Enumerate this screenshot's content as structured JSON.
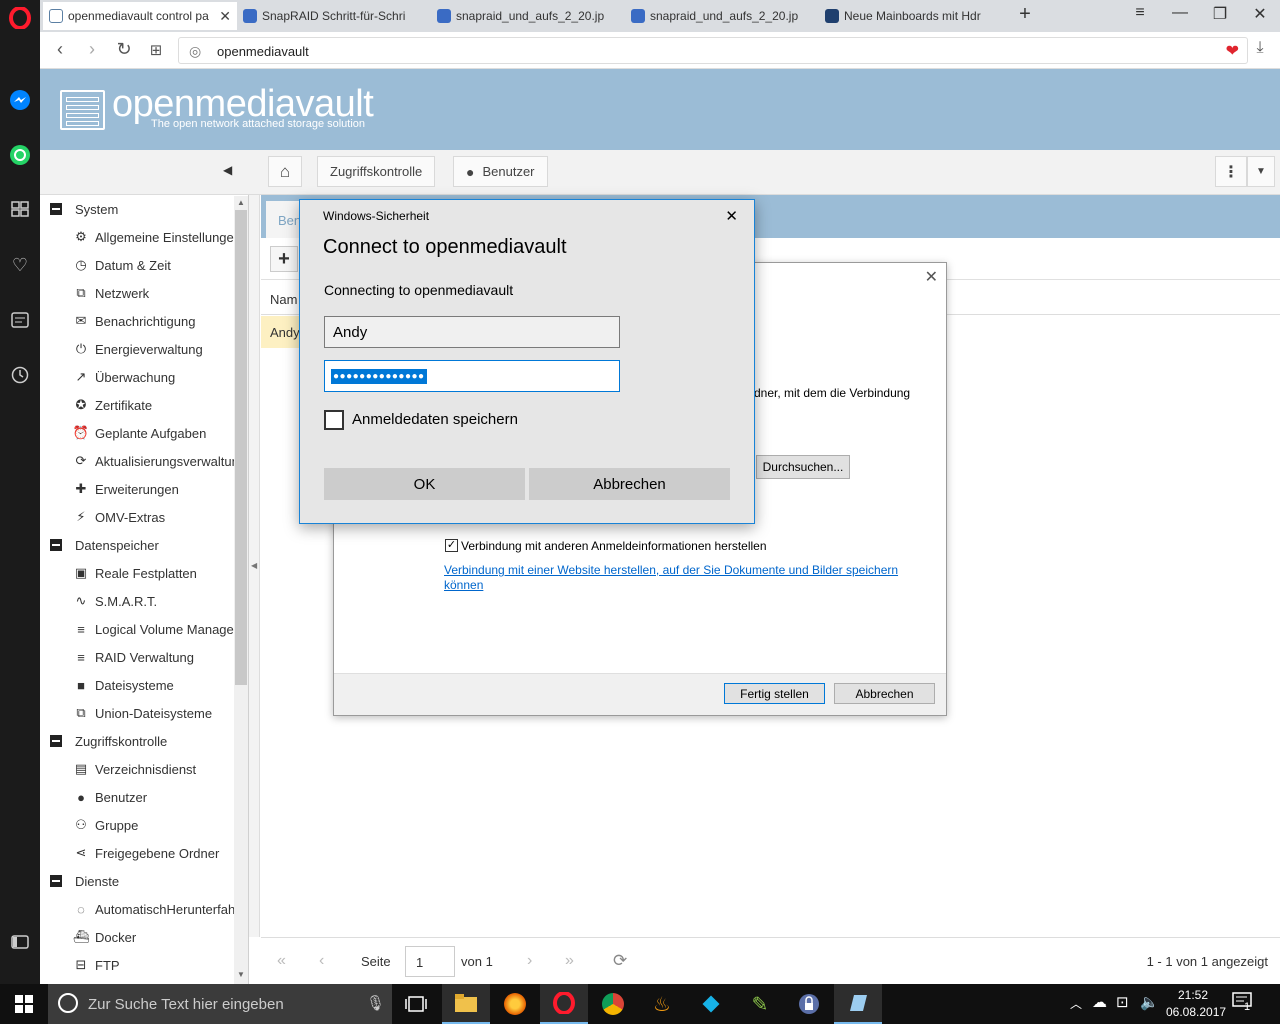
{
  "browser": {
    "tabs": [
      {
        "title": "openmediavault control pa",
        "active": true
      },
      {
        "title": "SnapRAID Schritt-für-Schri",
        "active": false
      },
      {
        "title": "snapraid_und_aufs_2_20.jp",
        "active": false
      },
      {
        "title": "snapraid_und_aufs_2_20.jp",
        "active": false
      },
      {
        "title": "Neue Mainboards mit Hdr",
        "active": false
      }
    ],
    "url": "openmediavault"
  },
  "omv": {
    "logo_title": "openmediavault",
    "logo_tagline": "The open network attached storage solution",
    "breadcrumb": [
      "Zugriffskontrolle",
      "Benutzer"
    ]
  },
  "nav": {
    "groups": [
      {
        "label": "System",
        "items": [
          {
            "icon": "gears-icon",
            "glyph": "⚙",
            "label": "Allgemeine Einstellungen"
          },
          {
            "icon": "clock-icon",
            "glyph": "◷",
            "label": "Datum & Zeit"
          },
          {
            "icon": "network-icon",
            "glyph": "⧉",
            "label": "Netzwerk"
          },
          {
            "icon": "envelope-icon",
            "glyph": "✉",
            "label": "Benachrichtigung"
          },
          {
            "icon": "power-icon",
            "glyph": "⏻",
            "label": "Energieverwaltung"
          },
          {
            "icon": "chart-line-icon",
            "glyph": "↗",
            "label": "Überwachung"
          },
          {
            "icon": "certificate-icon",
            "glyph": "✪",
            "label": "Zertifikate"
          },
          {
            "icon": "alarm-clock-icon",
            "glyph": "⏰",
            "label": "Geplante Aufgaben"
          },
          {
            "icon": "update-icon",
            "glyph": "⟳",
            "label": "Aktualisierungsverwaltung"
          },
          {
            "icon": "puzzle-icon",
            "glyph": "✚",
            "label": "Erweiterungen"
          },
          {
            "icon": "plug-icon",
            "glyph": "⚡",
            "label": "OMV-Extras"
          }
        ]
      },
      {
        "label": "Datenspeicher",
        "items": [
          {
            "icon": "harddisk-icon",
            "glyph": "▣",
            "label": "Reale Festplatten"
          },
          {
            "icon": "smart-chart-icon",
            "glyph": "∿",
            "label": "S.M.A.R.T."
          },
          {
            "icon": "database-icon",
            "glyph": "≡",
            "label": "Logical Volume Management"
          },
          {
            "icon": "raid-icon",
            "glyph": "≡",
            "label": "RAID Verwaltung"
          },
          {
            "icon": "folder-icon",
            "glyph": "■",
            "label": "Dateisysteme"
          },
          {
            "icon": "union-tree-icon",
            "glyph": "⧉",
            "label": "Union-Dateisysteme"
          }
        ]
      },
      {
        "label": "Zugriffskontrolle",
        "items": [
          {
            "icon": "directory-icon",
            "glyph": "▤",
            "label": "Verzeichnisdienst"
          },
          {
            "icon": "user-icon",
            "glyph": "●",
            "label": "Benutzer"
          },
          {
            "icon": "group-icon",
            "glyph": "⚇",
            "label": "Gruppe"
          },
          {
            "icon": "share-icon",
            "glyph": "⋖",
            "label": "Freigegebene Ordner"
          }
        ]
      },
      {
        "label": "Dienste",
        "items": [
          {
            "icon": "auto-shutdown-icon",
            "glyph": "◌",
            "label": "AutomatischHerunterfahren"
          },
          {
            "icon": "docker-icon",
            "glyph": "⛴",
            "label": "Docker"
          },
          {
            "icon": "ftp-icon",
            "glyph": "⊟",
            "label": "FTP"
          }
        ]
      }
    ]
  },
  "panel": {
    "tab_label": "Ben",
    "column_name": "Nam",
    "row_user": "Andy"
  },
  "wizard": {
    "partial_text": "dner, mit dem die Verbindung",
    "browse_button": "Durchsuchen...",
    "checkbox_label": "Verbindung mit anderen Anmeldeinformationen herstellen",
    "link_text_1": "Verbindung mit einer Website herstellen, auf der Sie Dokumente und Bilder speichern",
    "link_text_2": "können",
    "finish_button": "Fertig stellen",
    "cancel_button": "Abbrechen"
  },
  "security_dialog": {
    "window_title": "Windows-Sicherheit",
    "heading": "Connect to openmediavault",
    "subtext": "Connecting to openmediavault",
    "username_value": "Andy",
    "password_value": "●●●●●●●●●●●●●●",
    "remember_label": "Anmeldedaten speichern",
    "ok_button": "OK",
    "cancel_button": "Abbrechen"
  },
  "pager": {
    "page_label": "Seite",
    "page_value": "1",
    "of_label": "von 1",
    "summary": "1 - 1 von 1 angezeigt"
  },
  "taskbar": {
    "search_placeholder": "Zur Suche Text hier eingeben",
    "time": "21:52",
    "date": "06.08.2017",
    "notification_count": "1"
  },
  "colors": {
    "omv_header": "#9bbcd6",
    "opera_red": "#ff1b2d",
    "win_accent": "#1883d7",
    "row_highlight": "#fdf0c2"
  }
}
